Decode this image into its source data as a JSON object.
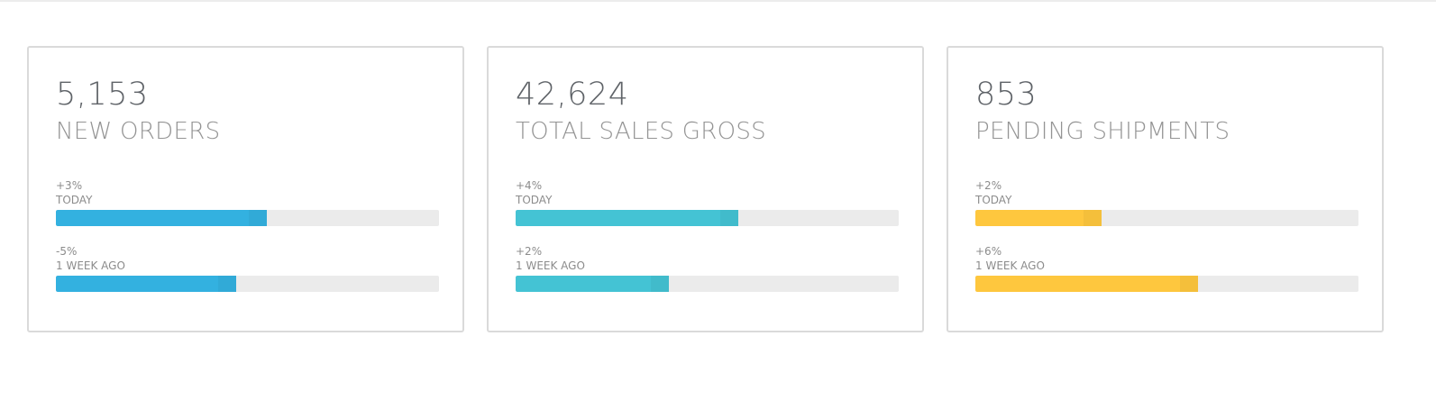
{
  "cards": [
    {
      "value": "5,153",
      "label": "NEW ORDERS",
      "color": "#33b1e0",
      "metrics": [
        {
          "change": "+3%",
          "period": "TODAY",
          "fill": 0.55
        },
        {
          "change": "-5%",
          "period": "1 WEEK AGO",
          "fill": 0.47
        }
      ]
    },
    {
      "value": "42,624",
      "label": "TOTAL SALES GROSS",
      "color": "#44c3d4",
      "metrics": [
        {
          "change": "+4%",
          "period": "TODAY",
          "fill": 0.58
        },
        {
          "change": "+2%",
          "period": "1 WEEK AGO",
          "fill": 0.4
        }
      ]
    },
    {
      "value": "853",
      "label": "PENDING SHIPMENTS",
      "color": "#fec73e",
      "metrics": [
        {
          "change": "+2%",
          "period": "TODAY",
          "fill": 0.33
        },
        {
          "change": "+6%",
          "period": "1 WEEK AGO",
          "fill": 0.58
        }
      ]
    }
  ],
  "colors": {
    "track": "#ebebeb",
    "border": "#dadada",
    "value_text": "#5f6368",
    "label_text": "#949494"
  }
}
